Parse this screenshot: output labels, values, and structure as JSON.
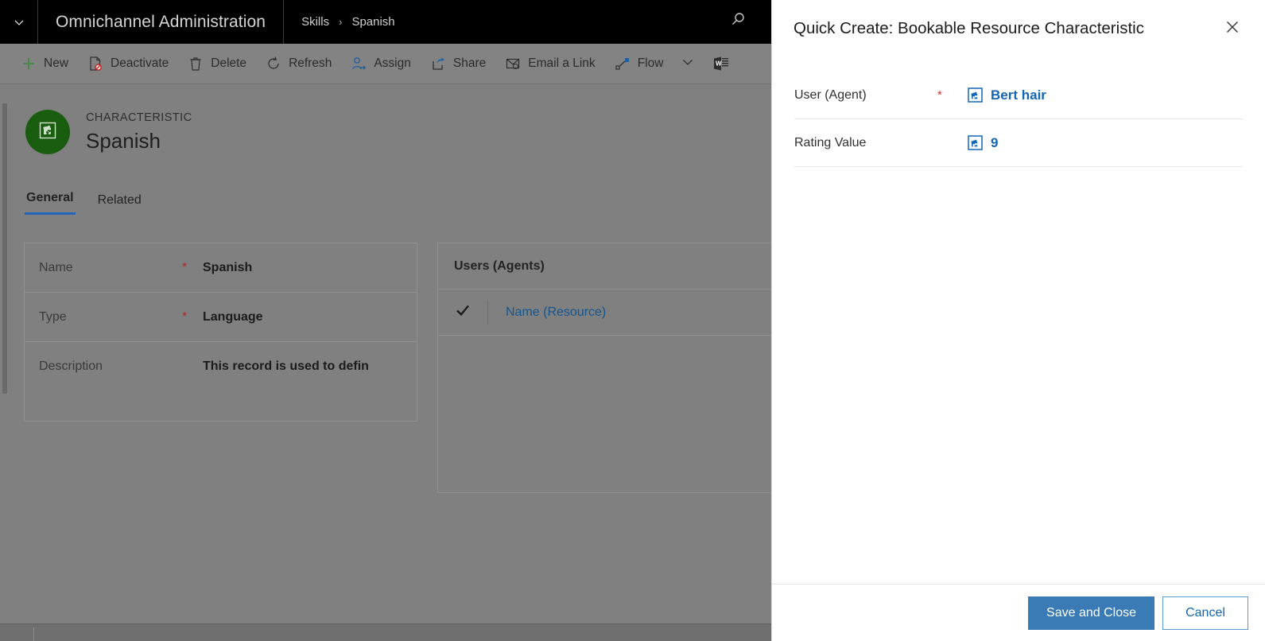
{
  "titlebar": {
    "app_title": "Omnichannel Administration",
    "breadcrumb": {
      "parent": "Skills",
      "separator": "›",
      "current": "Spanish"
    },
    "chevron_icon": "chevron-down-icon",
    "search_icon": "search-icon"
  },
  "commandbar": {
    "items": [
      {
        "label": "New",
        "icon": "plus-icon"
      },
      {
        "label": "Deactivate",
        "icon": "deactivate-icon"
      },
      {
        "label": "Delete",
        "icon": "trash-icon"
      },
      {
        "label": "Refresh",
        "icon": "refresh-icon"
      },
      {
        "label": "Assign",
        "icon": "assign-person-icon"
      },
      {
        "label": "Share",
        "icon": "share-icon"
      },
      {
        "label": "Email a Link",
        "icon": "email-link-icon"
      },
      {
        "label": "Flow",
        "icon": "flow-icon"
      }
    ],
    "overflow_icon": "chevron-down-icon",
    "word_templates_icon": "word-template-icon"
  },
  "record_header": {
    "entity_type": "CHARACTERISTIC",
    "record_name": "Spanish",
    "avatar_icon": "characteristic-icon",
    "avatar_color": "#1a5c10"
  },
  "tabs": [
    {
      "label": "General",
      "active": true
    },
    {
      "label": "Related",
      "active": false
    }
  ],
  "form": {
    "rows": [
      {
        "label": "Name",
        "required": "*",
        "value": "Spanish"
      },
      {
        "label": "Type",
        "required": "*",
        "value": "Language"
      },
      {
        "label": "Description",
        "required": "",
        "value": "This record is used to defin"
      }
    ]
  },
  "subgrid": {
    "title": "Users (Agents)",
    "check_icon": "checkmark-icon",
    "column_header": "Name (Resource)"
  },
  "quick_create": {
    "title": "Quick Create: Bookable Resource Characteristic",
    "close_icon": "close-icon",
    "fields": [
      {
        "label": "User (Agent)",
        "required": "*",
        "icon": "entity-record-icon",
        "value": "Bert hair"
      },
      {
        "label": "Rating Value",
        "required": "",
        "icon": "entity-record-icon",
        "value": "9"
      }
    ],
    "footer": {
      "save_label": "Save and Close",
      "cancel_label": "Cancel"
    }
  },
  "colors": {
    "primary_button": "#3a7ab5",
    "link": "#1266b3",
    "required_asterisk": "#d32f2f",
    "tab_underline": "#2266bb",
    "titlebar_bg": "#000000",
    "dim_overlay": "#808080"
  }
}
